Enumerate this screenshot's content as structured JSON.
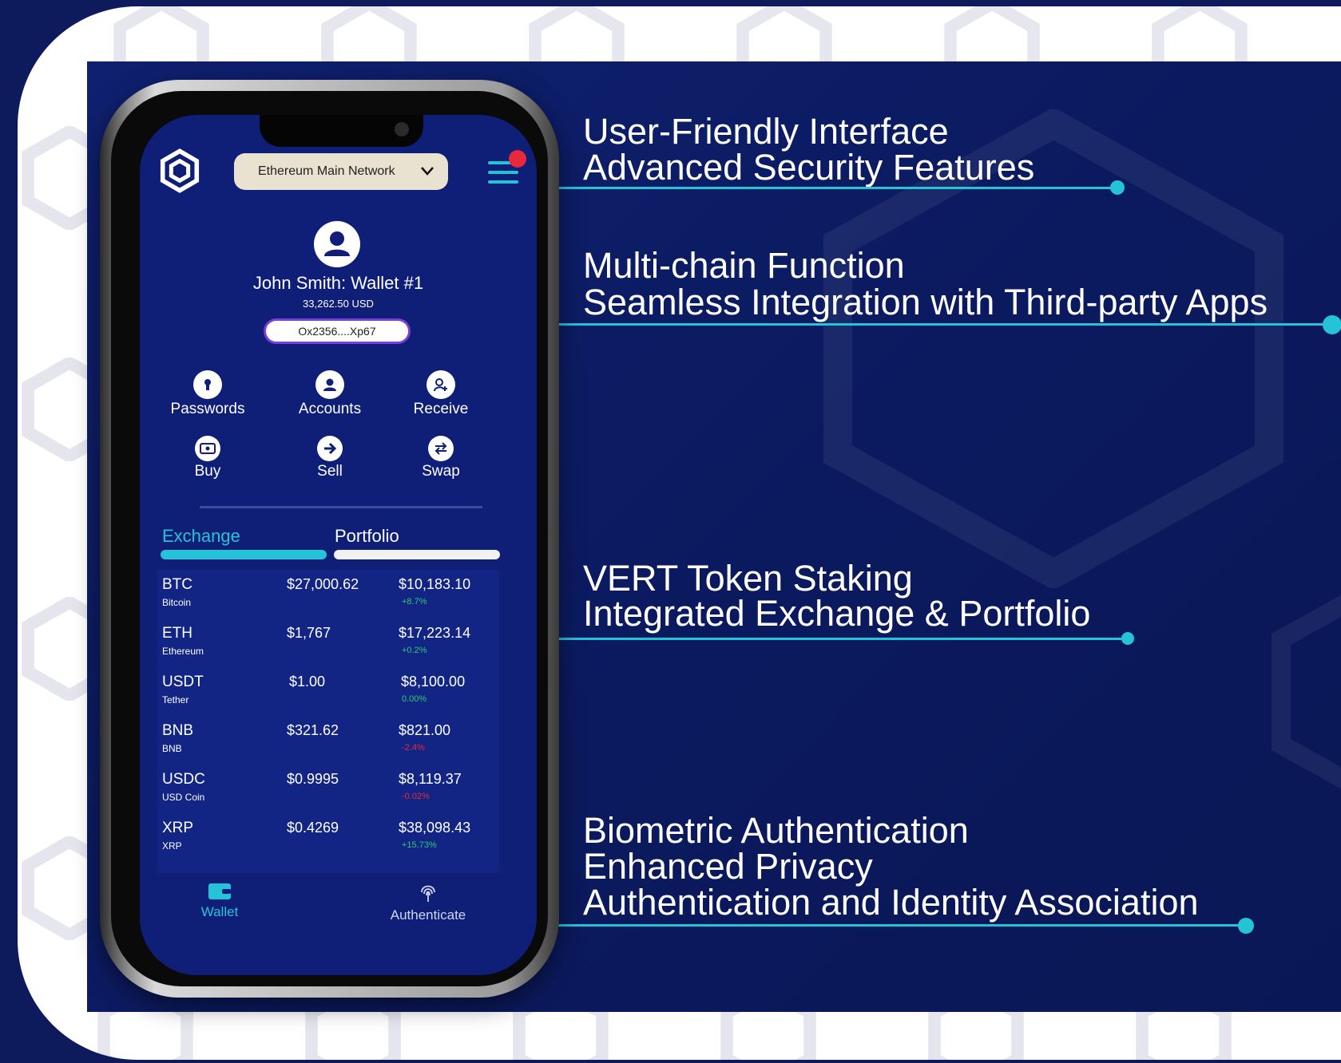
{
  "colors": {
    "accent": "#25c3d8",
    "navy": "#0d1a5c",
    "screen": "#0f1f78",
    "positive": "#2ecc71",
    "negative": "#e8283b",
    "address_border": "#7a3fd6"
  },
  "app": {
    "network": "Ethereum Main Network",
    "wallet_name": "John Smith: Wallet #1",
    "balance": "33,262.50 USD",
    "address": "Ox2356....Xp67",
    "actions": [
      {
        "label": "Passwords",
        "icon": "keyhole-icon"
      },
      {
        "label": "Accounts",
        "icon": "user-icon"
      },
      {
        "label": "Receive",
        "icon": "user-plus-icon"
      },
      {
        "label": "Buy",
        "icon": "cash-icon"
      },
      {
        "label": "Sell",
        "icon": "arrow-right-icon"
      },
      {
        "label": "Swap",
        "icon": "swap-icon"
      }
    ],
    "tabs": {
      "exchange": "Exchange",
      "portfolio": "Portfolio"
    },
    "assets": [
      {
        "symbol": "BTC",
        "name": "Bitcoin",
        "price": "$27,000.62",
        "holding": "$10,183.10",
        "change": "+8.7%",
        "direction": "up"
      },
      {
        "symbol": "ETH",
        "name": "Ethereum",
        "price": "$1,767",
        "holding": "$17,223.14",
        "change": "+0.2%",
        "direction": "up"
      },
      {
        "symbol": "USDT",
        "name": "Tether",
        "price": "$1.00",
        "holding": "$8,100.00",
        "change": "0.00%",
        "direction": "up"
      },
      {
        "symbol": "BNB",
        "name": "BNB",
        "price": "$321.62",
        "holding": "$821.00",
        "change": "-2.4%",
        "direction": "down"
      },
      {
        "symbol": "USDC",
        "name": "USD Coin",
        "price": "$0.9995",
        "holding": "$8,119.37",
        "change": "-0.02%",
        "direction": "down"
      },
      {
        "symbol": "XRP",
        "name": "XRP",
        "price": "$0.4269",
        "holding": "$38,098.43",
        "change": "+15.73%",
        "direction": "up"
      }
    ],
    "nav": {
      "wallet": "Wallet",
      "authenticate": "Authenticate"
    }
  },
  "features": {
    "group1": [
      "User-Friendly Interface",
      "Advanced Security Features"
    ],
    "group2": [
      "Multi-chain Function",
      "Seamless Integration with Third-party Apps"
    ],
    "group3": [
      "VERT Token Staking",
      "Integrated Exchange & Portfolio"
    ],
    "group4": [
      "Biometric Authentication",
      "Enhanced Privacy",
      "Authentication and Identity Association"
    ]
  }
}
